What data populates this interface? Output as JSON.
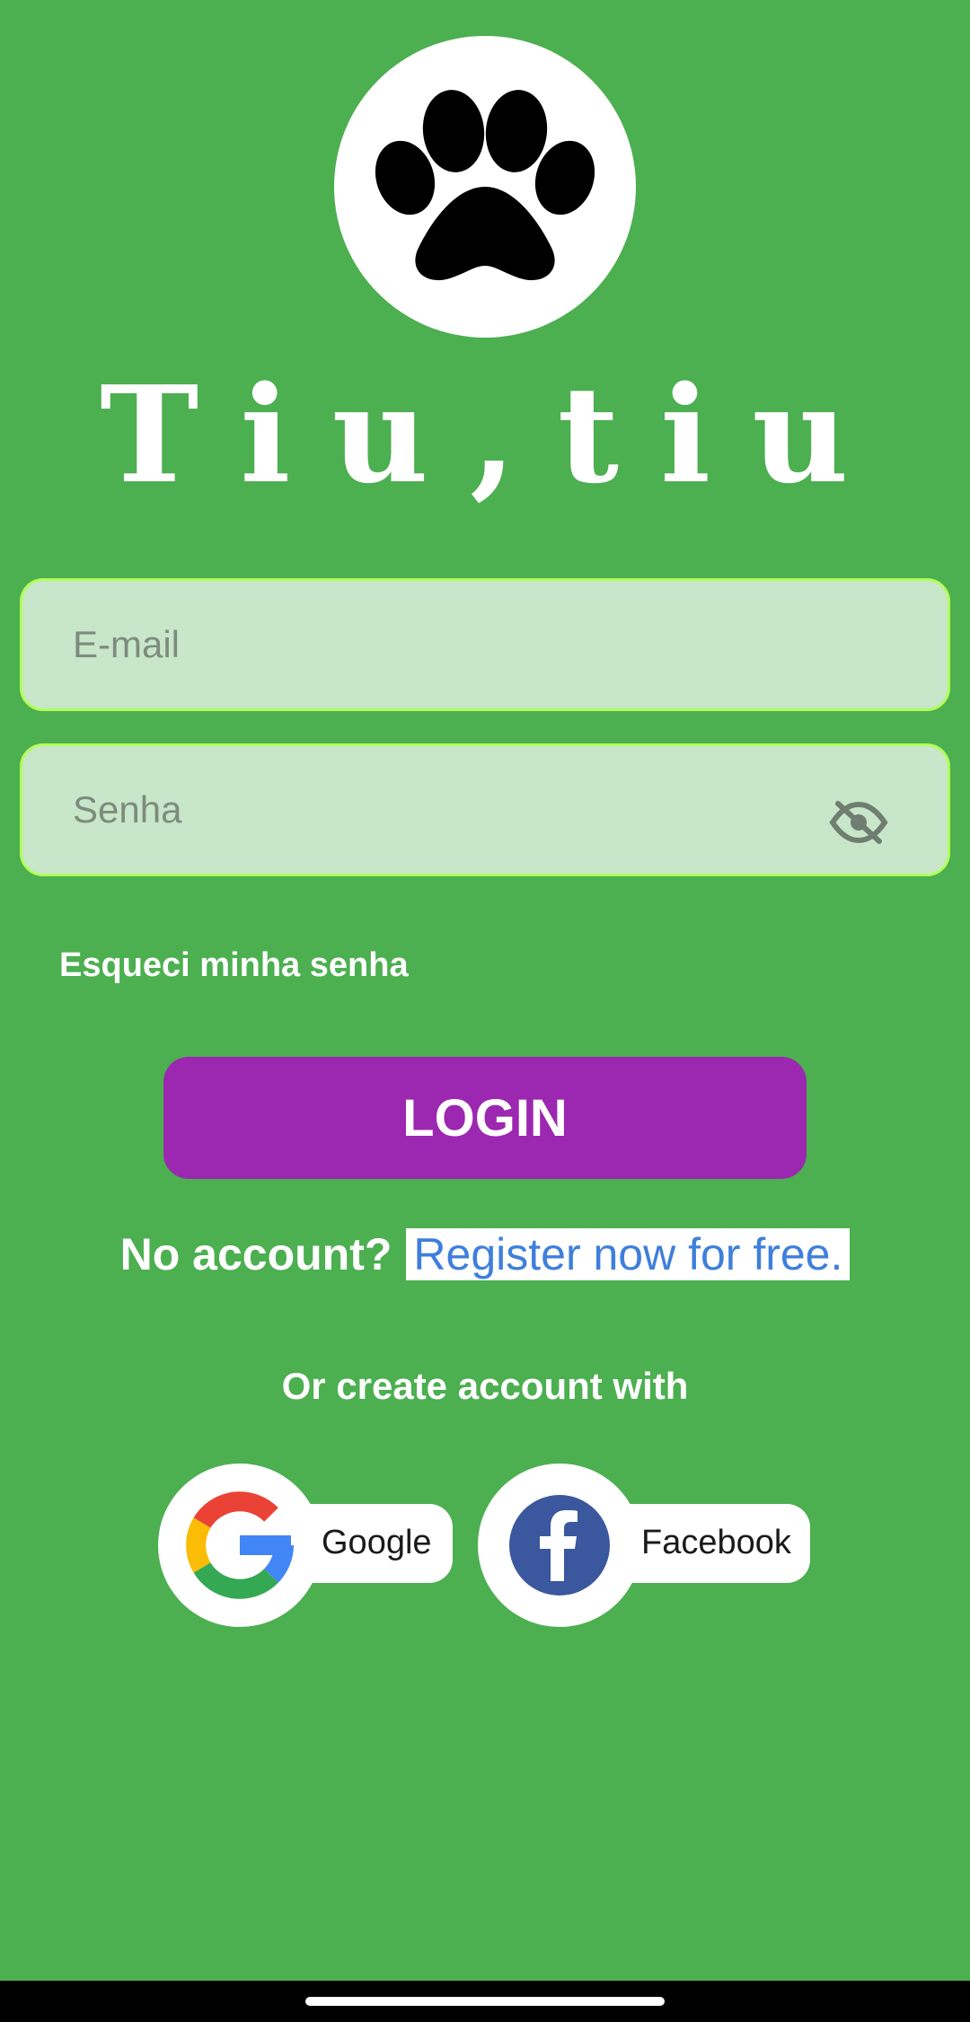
{
  "app": {
    "title": "Tiu,tiu",
    "logo_icon": "paw-icon"
  },
  "login_form": {
    "email_placeholder": "E-mail",
    "password_placeholder": "Senha",
    "password_toggle_icon": "eye-off-icon",
    "forgot_password": "Esqueci minha senha",
    "login_button": "LOGIN"
  },
  "register": {
    "prompt": "No account?",
    "link": "Register now for free."
  },
  "social_login": {
    "heading": "Or create account with",
    "providers": [
      {
        "label": "Google",
        "icon": "google-icon"
      },
      {
        "label": "Facebook",
        "icon": "facebook-icon"
      }
    ]
  },
  "colors": {
    "background": "#4caf50",
    "field_fill": "#c8e6c9",
    "field_border": "#b2ff59",
    "login_button": "#9c27b0",
    "link": "#3f7fdc",
    "facebook_blue": "#3b579d"
  }
}
